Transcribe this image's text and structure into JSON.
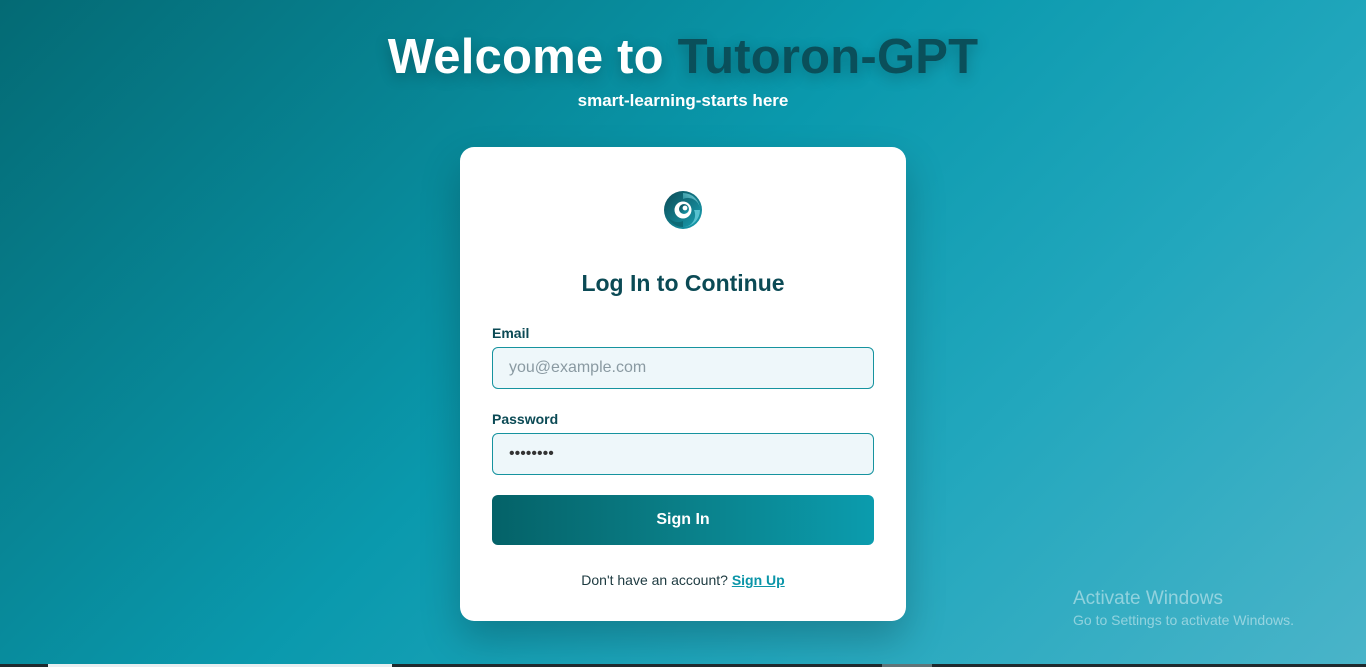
{
  "hero": {
    "title_prefix": "Welcome to ",
    "title_brand": "Tutoron-GPT",
    "tagline": "smart-learning-starts here"
  },
  "login": {
    "heading": "Log In to Continue",
    "email_label": "Email",
    "email_placeholder": "you@example.com",
    "email_value": "",
    "password_label": "Password",
    "password_value": "password",
    "submit_label": "Sign In",
    "no_account_text": "Don't have an account? ",
    "signup_link": "Sign Up"
  },
  "watermark": {
    "line1": "Activate Windows",
    "line2": "Go to Settings to activate Windows."
  },
  "icons": {
    "logo": "swirl-logo-icon"
  },
  "colors": {
    "brand_dark": "#0b4a55",
    "accent": "#0b95a8",
    "input_border": "#16939f"
  }
}
